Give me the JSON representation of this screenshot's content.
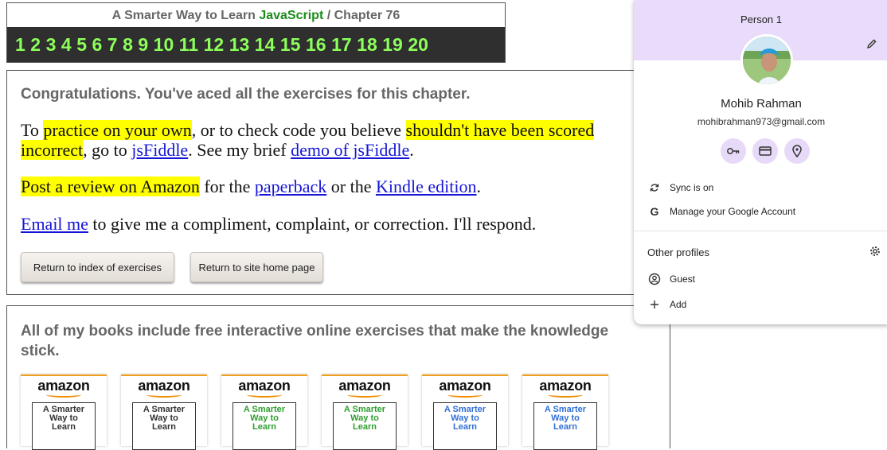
{
  "header": {
    "title_prefix": "A Smarter Way to Learn",
    "title_brand": "JavaScript",
    "title_sep": "/",
    "title_chapter": "Chapter 76",
    "numbers": [
      "1",
      "2",
      "3",
      "4",
      "5",
      "6",
      "7",
      "8",
      "9",
      "10",
      "11",
      "12",
      "13",
      "14",
      "15",
      "16",
      "17",
      "18",
      "19",
      "20"
    ]
  },
  "congrats": {
    "heading": "Congratulations. You've aced all the exercises for this chapter.",
    "p1": {
      "a": "To ",
      "hl1": "practice on your own",
      "b": ", or to check code you believe ",
      "hl2": "shouldn't have been scored incorrect",
      "c": ", go to ",
      "link1": "jsFiddle",
      "d": ". See my brief ",
      "link2": "demo of jsFiddle",
      "e": "."
    },
    "p2": {
      "hl": "Post a review on Amazon",
      "a": " for the ",
      "link1": "paperback",
      "b": " or the ",
      "link2": "Kindle edition",
      "c": "."
    },
    "p3": {
      "link": "Email me",
      "a": " to give me a compliment, complaint, or correction. I'll respond."
    },
    "btn_index": "Return to index of exercises",
    "btn_home": "Return to site home page"
  },
  "books": {
    "heading": "All of my books include free interactive online exercises that make the knowledge stick.",
    "amazon_label": "amazon",
    "items": [
      {
        "cover": "A Smarter\nWay to\nLearn",
        "color": "#333333"
      },
      {
        "cover": "A Smarter\nWay to\nLearn",
        "color": "#333333"
      },
      {
        "cover": "A Smarter\nWay to\nLearn",
        "color": "#2e9e2e"
      },
      {
        "cover": "A Smarter\nWay to\nLearn",
        "color": "#2e9e2e"
      },
      {
        "cover": "A Smarter\nWay to\nLearn",
        "color": "#2f6fd6"
      },
      {
        "cover": "A Smarter\nWay to\nLearn",
        "color": "#2f6fd6"
      }
    ]
  },
  "profile": {
    "name_header": "Person 1",
    "user_name": "Mohib Rahman",
    "email": "mohibrahman973@gmail.com",
    "sync": "Sync is on",
    "manage": "Manage your Google Account",
    "other_profiles": "Other profiles",
    "guest": "Guest",
    "add": "Add",
    "accent": "#e9dcfa"
  }
}
